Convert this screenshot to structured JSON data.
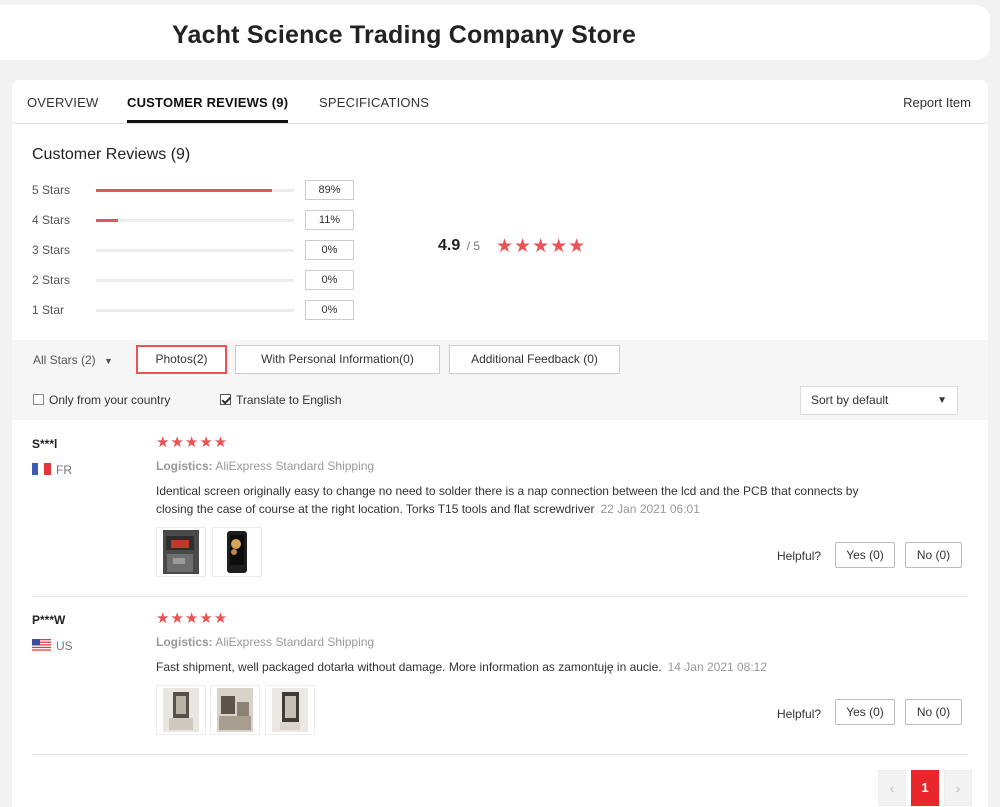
{
  "store": {
    "title": "Yacht Science Trading Company Store"
  },
  "tabs": [
    {
      "label": "OVERVIEW"
    },
    {
      "label": "CUSTOMER REVIEWS (9)"
    },
    {
      "label": "SPECIFICATIONS"
    }
  ],
  "report_label": "Report Item",
  "summary": {
    "heading": "Customer Reviews (9)",
    "rows": [
      {
        "label": "5 Stars",
        "pct": "89%",
        "fraction": 0.89
      },
      {
        "label": "4 Stars",
        "pct": "11%",
        "fraction": 0.11
      },
      {
        "label": "3 Stars",
        "pct": "0%",
        "fraction": 0
      },
      {
        "label": "2 Stars",
        "pct": "0%",
        "fraction": 0
      },
      {
        "label": "1 Star",
        "pct": "0%",
        "fraction": 0
      }
    ],
    "average": "4.9",
    "out_of": "/ 5",
    "average_stars": "★★★★★"
  },
  "filters": {
    "all_stars": "All Stars (2)",
    "chips": [
      {
        "label": "Photos(2)",
        "active": true
      },
      {
        "label": "With Personal Information(0)",
        "active": false
      },
      {
        "label": "Additional Feedback (0)",
        "active": false
      }
    ],
    "only_country": {
      "label": "Only from your country",
      "checked": false
    },
    "translate": {
      "label": "Translate to English",
      "checked": true
    },
    "sort": "Sort by default"
  },
  "reviews": [
    {
      "user": "S***l",
      "country": "FR",
      "stars": "★★★★★",
      "logistics_label": "Logistics:",
      "logistics": "AliExpress Standard Shipping",
      "text": "Identical screen originally easy to change no need to solder there is a nap connection between the lcd and the PCB that connects by closing the case of course at the right location. Torks T15 tools and flat screwdriver",
      "date": "22 Jan 2021 06:01",
      "helpful_label": "Helpful?",
      "yes": "Yes (0)",
      "no": "No (0)"
    },
    {
      "user": "P***W",
      "country": "US",
      "stars": "★★★★★",
      "logistics_label": "Logistics:",
      "logistics": "AliExpress Standard Shipping",
      "text": "Fast shipment, well packaged dotarła without damage. More information as zamontuję in aucie.",
      "date": "14 Jan 2021 08:12",
      "helpful_label": "Helpful?",
      "yes": "Yes (0)",
      "no": "No (0)"
    }
  ],
  "pagination": {
    "prev": "‹",
    "current": "1",
    "next": "›"
  },
  "colors": {
    "accent": "#e95355",
    "page_active": "#e8262b"
  }
}
